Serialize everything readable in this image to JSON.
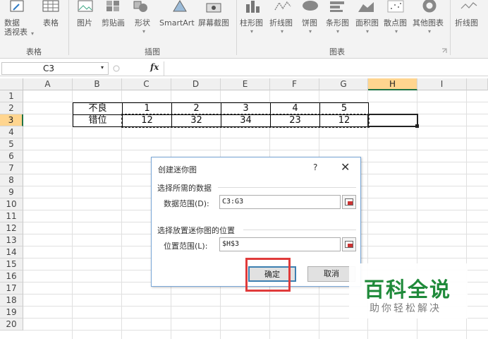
{
  "ribbon": {
    "items": [
      "数据\n透视表",
      "表格",
      "图片",
      "剪贴画",
      "形状",
      "SmartArt",
      "屏幕截图",
      "柱形图",
      "折线图",
      "饼图",
      "条形图",
      "面积图",
      "散点图",
      "其他图表",
      "折线图"
    ],
    "groups": [
      "表格",
      "插图",
      "图表"
    ]
  },
  "formula_bar": {
    "name_box": "C3",
    "fx": "fx",
    "formula": ""
  },
  "columns": [
    "A",
    "B",
    "C",
    "D",
    "E",
    "F",
    "G",
    "H",
    "I"
  ],
  "rows": [
    "1",
    "2",
    "3",
    "4",
    "5",
    "6",
    "7",
    "8",
    "9",
    "10",
    "11",
    "12",
    "13",
    "14",
    "15",
    "16",
    "17",
    "18",
    "19",
    "20"
  ],
  "cells": {
    "B2": "不良",
    "C2": "1",
    "D2": "2",
    "E2": "3",
    "F2": "4",
    "G2": "5",
    "B3": "错位",
    "C3": "12",
    "D3": "32",
    "E3": "34",
    "F3": "23",
    "G3": "12"
  },
  "dialog": {
    "title": "创建迷你图",
    "help": "?",
    "close": "✕",
    "section1": "选择所需的数据",
    "data_range_label": "数据范围(D):",
    "data_range_value": "C3:G3",
    "section2": "选择放置迷你图的位置",
    "location_label": "位置范围(L):",
    "location_value": "$H$3",
    "ok": "确定",
    "cancel": "取消"
  },
  "watermark": {
    "title": "百科全说",
    "subtitle": "助你轻松解决"
  },
  "colors": {
    "selection_header": "#ffd58f",
    "accent": "#217346",
    "highlight": "#e03b3b",
    "watermark": "#1f8a3a"
  }
}
